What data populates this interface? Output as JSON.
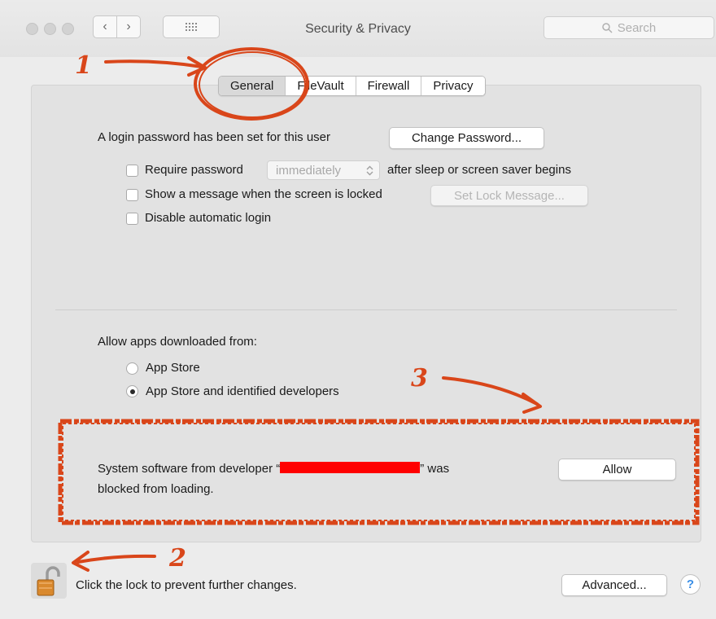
{
  "window": {
    "title": "Security & Privacy",
    "search_placeholder": "Search",
    "nav_back_icon": "chevron-left-icon",
    "nav_forward_icon": "chevron-right-icon",
    "grid_icon": "grid-icon"
  },
  "tabs": [
    {
      "label": "General",
      "selected": true
    },
    {
      "label": "FileVault",
      "selected": false
    },
    {
      "label": "Firewall",
      "selected": false
    },
    {
      "label": "Privacy",
      "selected": false
    }
  ],
  "general": {
    "login_password_text": "A login password has been set for this user",
    "change_password_button": "Change Password...",
    "require_password_label": "Require password",
    "require_password_select": "immediately",
    "after_sleep_text": "after sleep or screen saver begins",
    "show_message_label": "Show a message when the screen is locked",
    "set_lock_message_button": "Set Lock Message...",
    "disable_login_label": "Disable automatic login",
    "allow_apps_label": "Allow apps downloaded from:",
    "option_app_store": "App Store",
    "option_identified": "App Store and identified developers",
    "selected_option": "App Store and identified developers"
  },
  "blocked": {
    "text_prefix": "System software from developer “",
    "text_suffix": "” was",
    "text_line2": "blocked from loading.",
    "allow_button": "Allow"
  },
  "footer": {
    "lock_text": "Click the lock to prevent further changes.",
    "advanced_button": "Advanced...",
    "help_label": "?"
  },
  "annotations": {
    "one": "1",
    "two": "2",
    "three": "3",
    "color": "#d9461a"
  },
  "colors": {
    "window_bg": "#ececec",
    "panel_bg": "#e2e2e2",
    "redaction": "#ff0000",
    "help_accent": "#3a8ee6"
  }
}
